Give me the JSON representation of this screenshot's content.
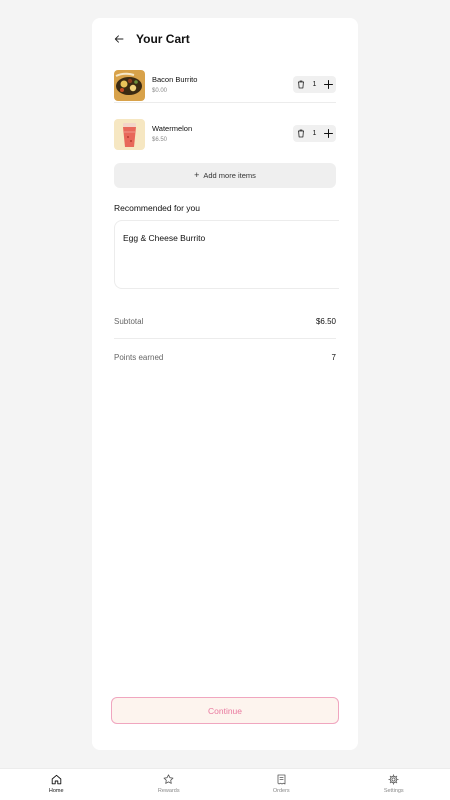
{
  "header": {
    "title": "Your Cart"
  },
  "cart": {
    "items": [
      {
        "name": "Bacon Burrito",
        "price": "$0.00",
        "quantity": "1"
      },
      {
        "name": "Watermelon",
        "price": "$6.50",
        "quantity": "1"
      }
    ],
    "add_more_label": "Add more items"
  },
  "recommended": {
    "title": "Recommended for you",
    "items": [
      {
        "name": "Egg & Cheese Burrito"
      }
    ]
  },
  "summary": {
    "subtotal_label": "Subtotal",
    "subtotal_value": "$6.50",
    "points_label": "Points earned",
    "points_value": "7"
  },
  "continue_label": "Continue",
  "tabs": [
    {
      "label": "Home",
      "icon": "home-icon",
      "active": true
    },
    {
      "label": "Rewards",
      "icon": "star-icon",
      "active": false
    },
    {
      "label": "Orders",
      "icon": "receipt-icon",
      "active": false
    },
    {
      "label": "Settings",
      "icon": "gear-icon",
      "active": false
    }
  ],
  "colors": {
    "accent_border": "#f0a6bf",
    "accent_text": "#e9799f",
    "accent_bg": "#fdf4ee",
    "page_bg": "#f4f4f4"
  }
}
